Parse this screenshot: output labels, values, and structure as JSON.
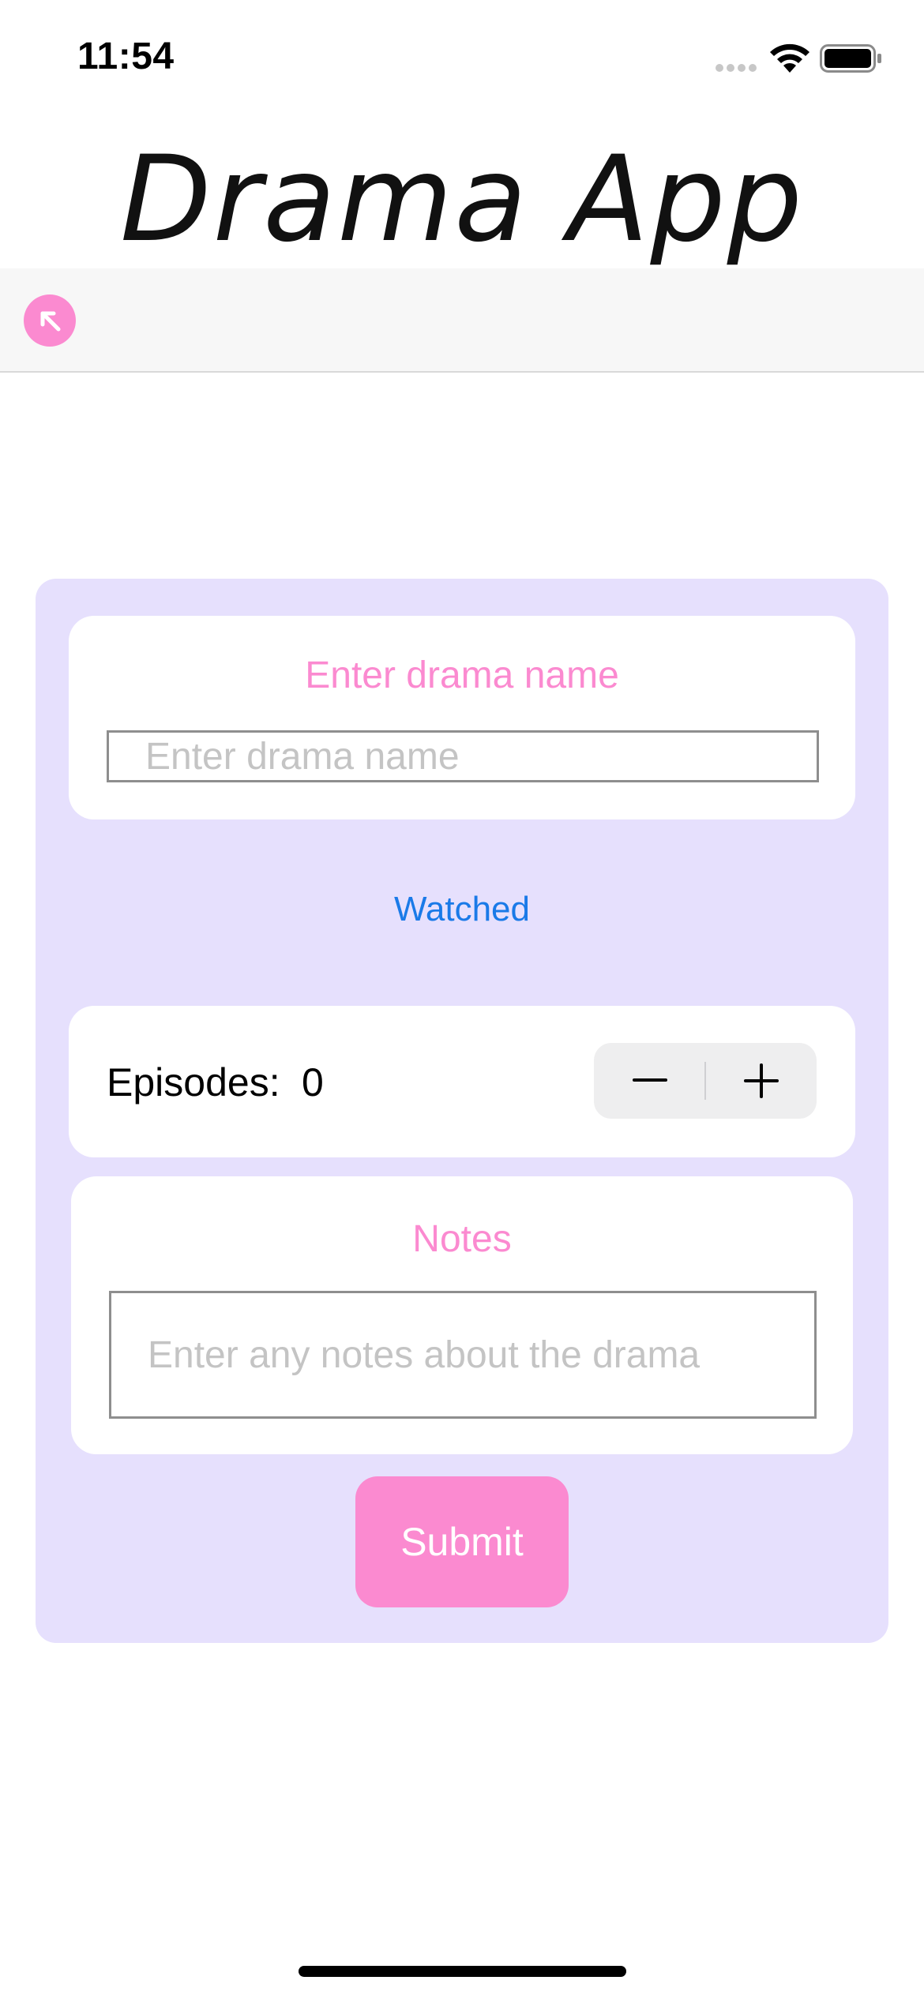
{
  "status_bar": {
    "time": "11:54",
    "icons": [
      "cellular-signal-icon",
      "wifi-icon",
      "battery-icon"
    ]
  },
  "header": {
    "title": "Drama App"
  },
  "nav": {
    "back_icon": "arrow-up-left-icon"
  },
  "form": {
    "name_heading": "Enter drama name",
    "name_input": {
      "value": "",
      "placeholder": "Enter drama name"
    },
    "watched_label": "Watched",
    "episodes": {
      "label": "Episodes:",
      "value": "0",
      "decrement_icon": "minus-icon",
      "increment_icon": "plus-icon"
    },
    "notes_heading": "Notes",
    "notes_input": {
      "value": "",
      "placeholder": "Enter any notes about the drama"
    },
    "submit_label": "Submit"
  },
  "colors": {
    "accent_pink": "#fb8ad0",
    "form_background": "#e6e0fd",
    "link_blue": "#1a7ae8",
    "nav_background": "#f7f7f7"
  }
}
